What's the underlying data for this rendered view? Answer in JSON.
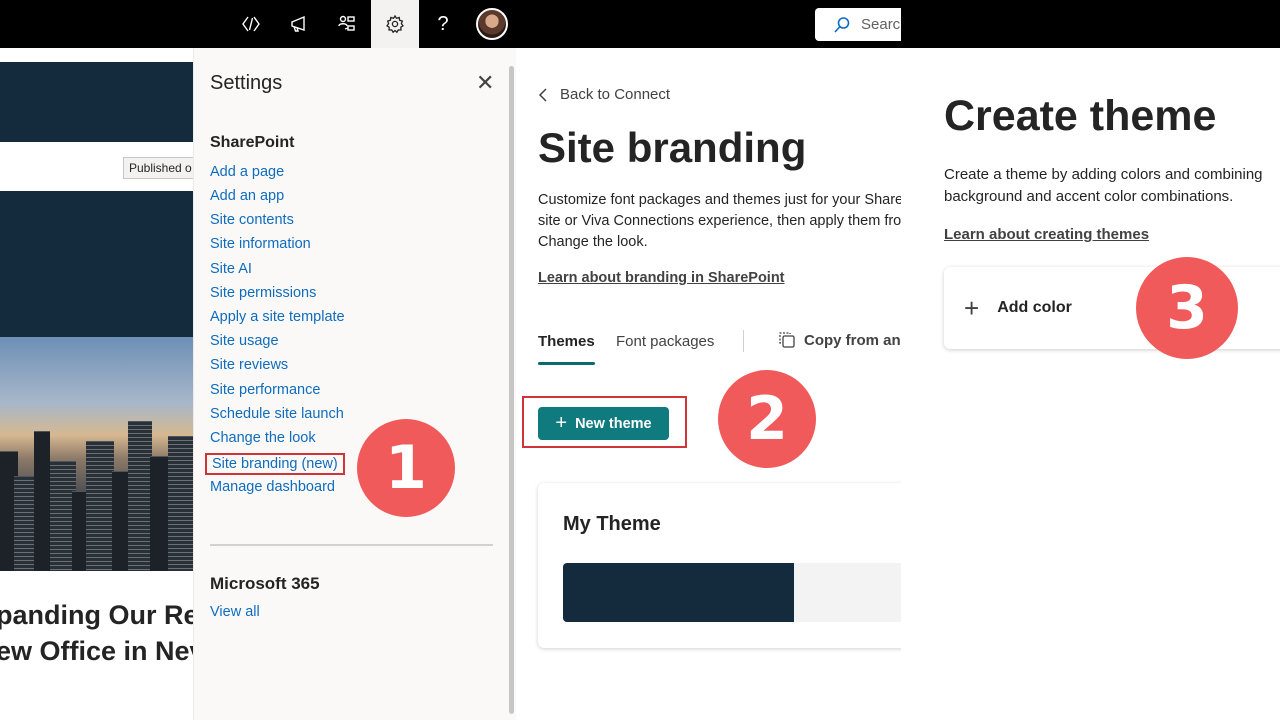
{
  "colors": {
    "topbar": "#000000",
    "navy": "#132b3d",
    "link": "#0f6cbd",
    "accent": "#0f7b7f",
    "highlight": "#d13438",
    "step": "#f05a5a"
  },
  "panel1": {
    "topbar_icons": [
      "code-icon",
      "megaphone-icon",
      "people-network-icon",
      "gear-icon",
      "help-icon",
      "user-avatar"
    ],
    "help_label": "?",
    "published_badge": "Published o",
    "headline_line1": "panding Our Re",
    "headline_line2": "ew Office in Nev",
    "settings": {
      "title": "Settings",
      "close_label": "✕",
      "sharepoint_heading": "SharePoint",
      "links": [
        "Add a page",
        "Add an app",
        "Site contents",
        "Site information",
        "Site AI",
        "Site permissions",
        "Apply a site template",
        "Site usage",
        "Site reviews",
        "Site performance",
        "Schedule site launch",
        "Change the look",
        "Site branding (new)",
        "Manage dashboard"
      ],
      "m365_heading": "Microsoft 365",
      "view_all": "View all"
    },
    "step": "1"
  },
  "panel2": {
    "search_placeholder": "Searc",
    "back_link": "Back to Connect",
    "title": "Site branding",
    "description": "Customize font packages and themes just for your Share site or Viva Connections experience, then apply them fro Change the look.",
    "learn_link": "Learn about branding in SharePoint",
    "tabs": [
      "Themes",
      "Font packages"
    ],
    "copy_button": "Copy from ano",
    "new_theme_button": "New theme",
    "step": "2",
    "theme_card": {
      "name": "My Theme",
      "swatches": [
        "#132b3d",
        "#f3f3f3"
      ]
    }
  },
  "panel3": {
    "title": "Create theme",
    "description": "Create a theme by adding colors and combining background and accent color combinations.",
    "learn_link": "Learn about creating themes",
    "add_color_button": "Add color",
    "step": "3"
  }
}
